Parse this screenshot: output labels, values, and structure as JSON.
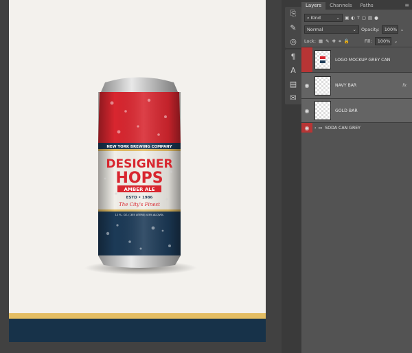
{
  "panel": {
    "tabs": [
      "Layers",
      "Channels",
      "Paths"
    ],
    "filter_kind": "Kind",
    "blend_mode": "Normal",
    "opacity_label": "Opacity:",
    "opacity_value": "100%",
    "lock_label": "Lock:",
    "fill_label": "Fill:",
    "fill_value": "100%"
  },
  "layers": [
    {
      "name": "LOGO MOCKUP GREY CAN",
      "fx": ""
    },
    {
      "name": "NAVY BAR",
      "fx": "fx"
    },
    {
      "name": "GOLD BAR",
      "fx": ""
    },
    {
      "name": "SODA CAN GREY",
      "fx": ""
    }
  ],
  "can": {
    "brewery": "NEW YORK BREWING COMPANY",
    "title_top": "DESIGNER",
    "title_bottom": "HOPS",
    "style": "AMBER ALE",
    "established": "ESTD • 1986",
    "tagline": "The City's Finest",
    "volume": "12 FL. OZ. (.355 LITERS) 4.5% ALC/VOL"
  },
  "colors": {
    "can_red": "#d8262f",
    "can_navy": "#1c3a57",
    "gold": "#e3bd63",
    "navy_bar": "#173249",
    "layer_highlight": "#b73535"
  }
}
